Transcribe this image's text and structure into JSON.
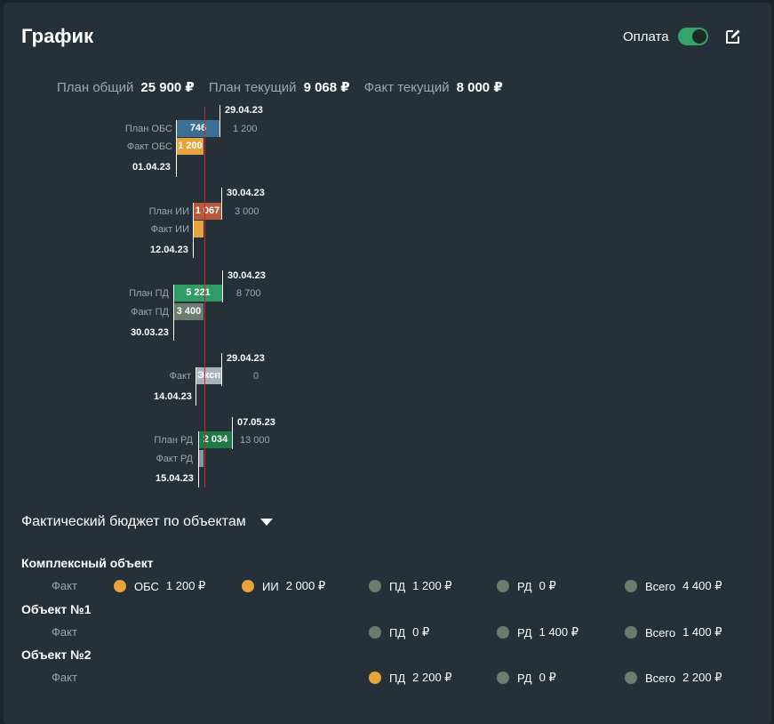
{
  "header": {
    "title": "График",
    "toggle_label": "Оплата",
    "toggle_on": true,
    "edit_icon": "pencil-square-icon"
  },
  "summary": {
    "plan_total_label": "План общий",
    "plan_total_value": "25 900 ₽",
    "plan_current_label": "План текущий",
    "plan_current_value": "9 068 ₽",
    "fact_current_label": "Факт текущий",
    "fact_current_value": "8 000 ₽"
  },
  "gantt": {
    "today_line_color": "#c8262b",
    "groups": [
      {
        "end_date": "29.04.23",
        "start_date": "01.04.23",
        "plan_label": "План ОБС",
        "plan_value": "746",
        "plan_color": "#3d6e94",
        "plan_total": "1 200",
        "fact_label": "Факт ОБС",
        "fact_value": "1 200",
        "fact_color": "#e8a43c"
      },
      {
        "end_date": "30.04.23",
        "start_date": "12.04.23",
        "plan_label": "План ИИ",
        "plan_value": "1 067",
        "plan_color": "#b55b3a",
        "plan_total": "3 000",
        "fact_label": "Факт ИИ",
        "fact_value": "",
        "fact_color": "#e8a43c"
      },
      {
        "end_date": "30.04.23",
        "start_date": "30.03.23",
        "plan_label": "План ПД",
        "plan_value": "5 221",
        "plan_color": "#2e9c63",
        "plan_total": "8 700",
        "fact_label": "Факт ПД",
        "fact_value": "3 400",
        "fact_color": "#6b7d70"
      },
      {
        "end_date": "29.04.23",
        "start_date": "14.04.23",
        "fact_label": "Факт",
        "fact_value": "Эксп",
        "fact_color": "#a9b2bb",
        "plan_total": "0"
      },
      {
        "end_date": "07.05.23",
        "start_date": "15.04.23",
        "plan_label": "План РД",
        "plan_value": "2 034",
        "plan_color": "#1f7a45",
        "plan_total": "13 000",
        "fact_label": "Факт РД",
        "fact_value": "",
        "fact_color": "#8a949c"
      }
    ]
  },
  "budget": {
    "section_title": "Фактический бюджет по объектам",
    "fact_label": "Факт",
    "objects": [
      {
        "name": "Комплексный объект",
        "items": [
          {
            "name": "ОБС",
            "value": "1 200 ₽",
            "color": "#e8a43c"
          },
          {
            "name": "ИИ",
            "value": "2 000 ₽",
            "color": "#e8a43c"
          },
          {
            "name": "ПД",
            "value": "1 200 ₽",
            "color": "#6b7d70"
          },
          {
            "name": "РД",
            "value": "0 ₽",
            "color": "#6b7d70"
          },
          {
            "name": "Всего",
            "value": "4 400 ₽",
            "color": "#6b7d70"
          }
        ]
      },
      {
        "name": "Объект №1",
        "items": [
          {
            "name": "ПД",
            "value": "0 ₽",
            "color": "#6b7d70"
          },
          {
            "name": "РД",
            "value": "1 400 ₽",
            "color": "#6b7d70"
          },
          {
            "name": "Всего",
            "value": "1 400 ₽",
            "color": "#6b7d70"
          }
        ]
      },
      {
        "name": "Объект №2",
        "items": [
          {
            "name": "ПД",
            "value": "2 200 ₽",
            "color": "#e8a43c"
          },
          {
            "name": "РД",
            "value": "0 ₽",
            "color": "#6b7d70"
          },
          {
            "name": "Всего",
            "value": "2 200 ₽",
            "color": "#6b7d70"
          }
        ]
      }
    ]
  }
}
